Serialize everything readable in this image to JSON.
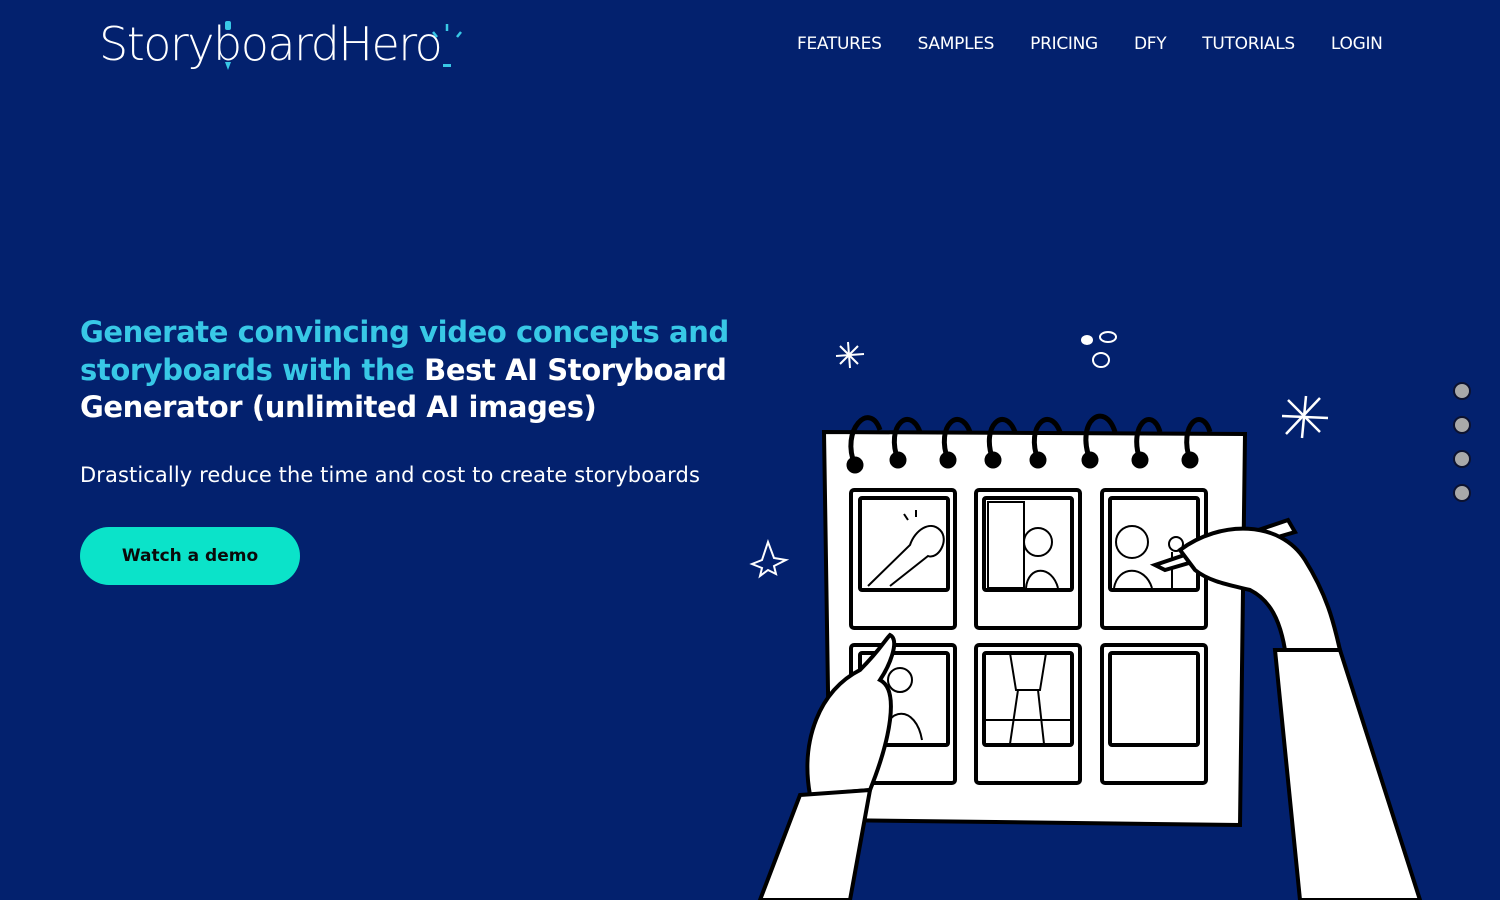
{
  "brand": {
    "name": "StoryboardHero",
    "accent_color": "#38c8e6",
    "background_color": "#03216e",
    "cta_color": "#0be3c9"
  },
  "nav": {
    "items": [
      {
        "label": "FEATURES"
      },
      {
        "label": "SAMPLES"
      },
      {
        "label": "PRICING"
      },
      {
        "label": "DFY"
      },
      {
        "label": "TUTORIALS"
      },
      {
        "label": "LOGIN"
      }
    ]
  },
  "hero": {
    "headline_accent": "Generate convincing video concepts and storyboards with the ",
    "headline_white": "Best AI Storyboard Generator (unlimited AI images)",
    "subtitle": "Drastically reduce the time and cost to create storyboards",
    "cta_label": "Watch a demo"
  },
  "slider": {
    "dot_count": 4
  },
  "illustration": {
    "icon": "storyboard-notebook-illustration"
  }
}
